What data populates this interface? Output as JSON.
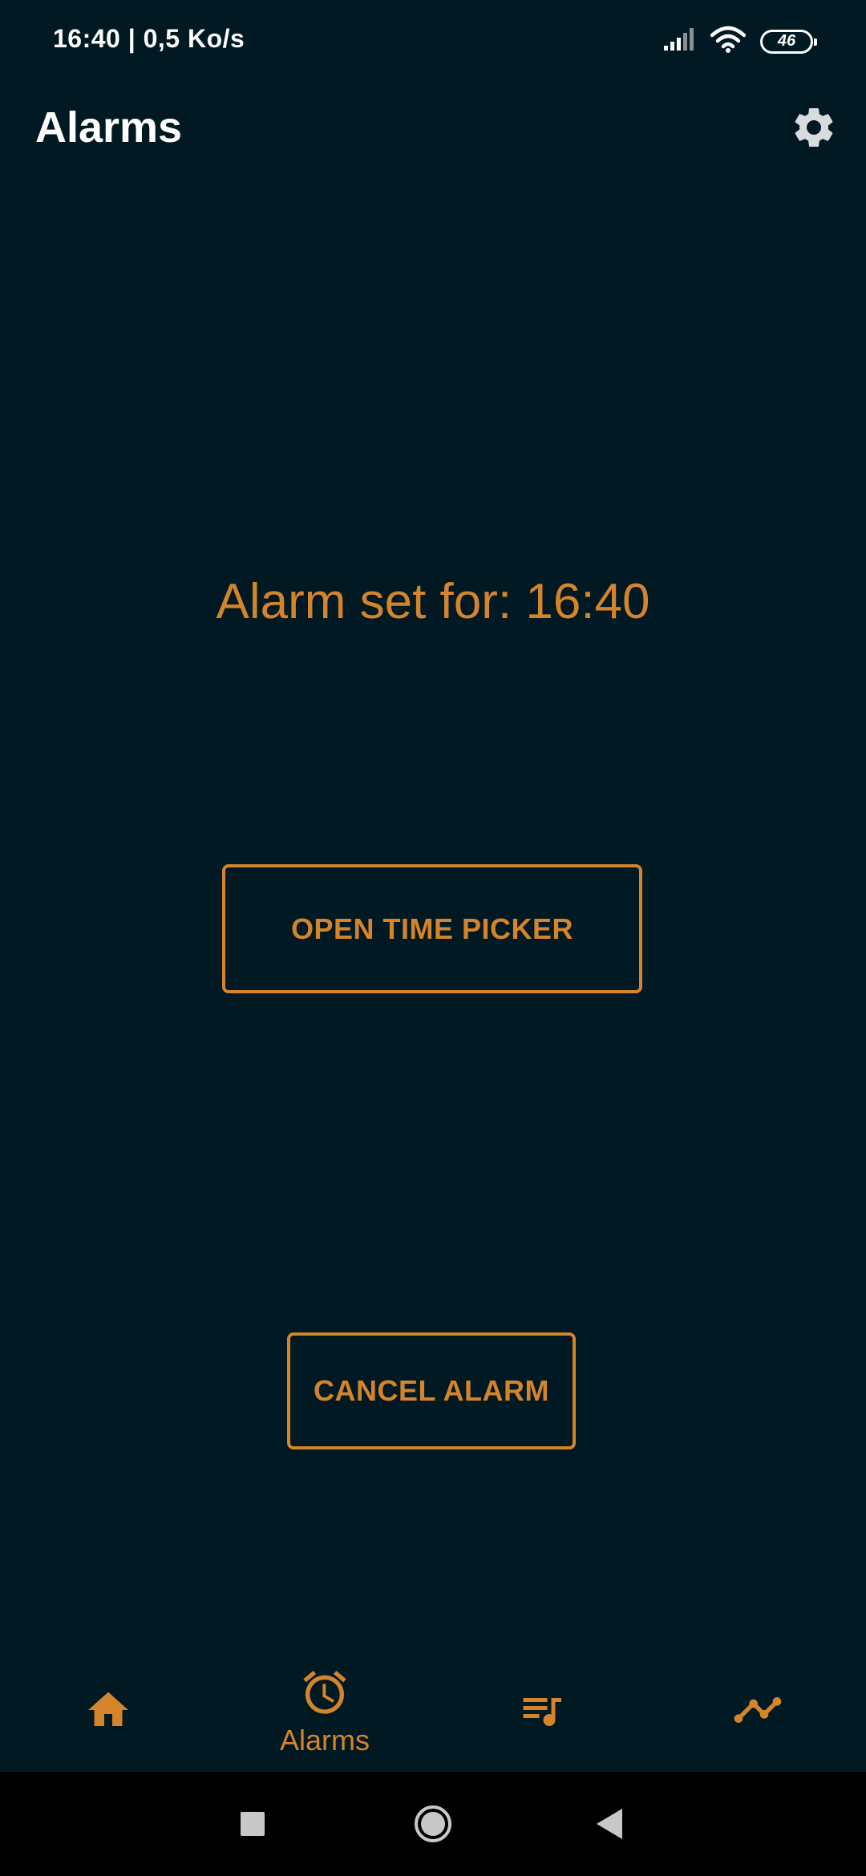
{
  "status_bar": {
    "text": "16:40 | 0,5 Ko/s",
    "battery": "46"
  },
  "app_bar": {
    "title": "Alarms"
  },
  "main": {
    "alarm_status": "Alarm set for: 16:40",
    "open_picker_label": "OPEN TIME PICKER",
    "cancel_label": "CANCEL ALARM"
  },
  "bottom_nav": {
    "items": [
      {
        "icon": "home-icon",
        "label": ""
      },
      {
        "icon": "alarm-clock-icon",
        "label": "Alarms"
      },
      {
        "icon": "playlist-music-icon",
        "label": ""
      },
      {
        "icon": "trending-line-icon",
        "label": ""
      }
    ]
  },
  "colors": {
    "background": "#011923",
    "accent": "#d4842a",
    "text_primary": "#ffffff"
  }
}
